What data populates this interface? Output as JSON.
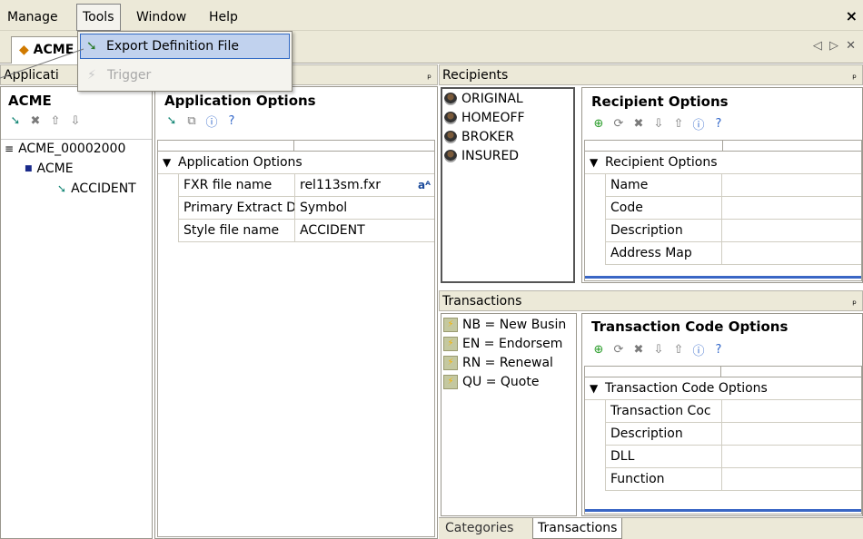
{
  "menubar": {
    "items": [
      "Manage",
      "Tools",
      "Window",
      "Help"
    ],
    "close_label": "×"
  },
  "tools_menu": {
    "export_label": "Export Definition File",
    "trigger_label": "Trigger"
  },
  "doc_tab": {
    "label": "ACME",
    "nav": "◁ ▷ ✕"
  },
  "applications_panel": {
    "header": "Applicati",
    "title": "ACME",
    "tree": {
      "root": "ACME_00002000",
      "child": "ACME",
      "grandchild": "ACCIDENT"
    }
  },
  "app_options": {
    "header_pin": "ᵖ",
    "title": "Application Options",
    "category": "Application Options",
    "rows": [
      {
        "key": "FXR file name",
        "value": "rel113sm.fxr"
      },
      {
        "key": "Primary Extract D",
        "value": "Symbol"
      },
      {
        "key": "Style file name",
        "value": "ACCIDENT"
      }
    ]
  },
  "recipients": {
    "header": "Recipients",
    "items": [
      "ORIGINAL",
      "HOMEOFF",
      "BROKER",
      "INSURED"
    ],
    "options_title": "Recipient Options",
    "category": "Recipient Options",
    "rows": [
      "Name",
      "Code",
      "Description",
      "Address Map"
    ]
  },
  "transactions": {
    "header": "Transactions",
    "items": [
      "NB = New Busin",
      "EN = Endorsem",
      "RN = Renewal",
      "QU = Quote"
    ],
    "options_title": "Transaction Code Options",
    "category": "Transaction Code Options",
    "rows": [
      "Transaction Coc",
      "Description",
      "DLL",
      "Function"
    ]
  },
  "bottom_tabs": [
    "Categories",
    "Transactions"
  ],
  "colors": {
    "chrome": "#ece9d8",
    "menu_highlight": "#c1d2ee",
    "menu_highlight_border": "#316ac5"
  }
}
